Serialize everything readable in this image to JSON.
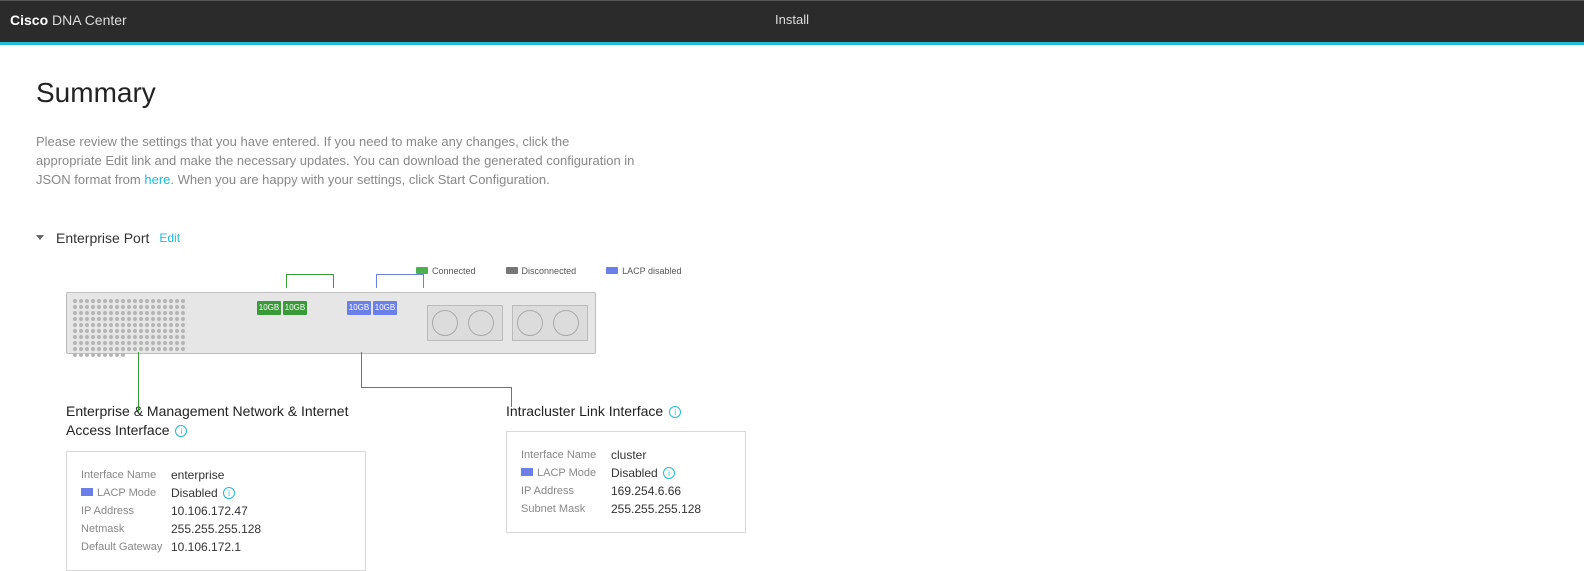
{
  "brand_bold": "Cisco",
  "brand_rest": " DNA Center",
  "tab": "Install",
  "title": "Summary",
  "intro1": "Please review the settings that you have entered. If you need to make any changes, click the appropriate Edit link and make the necessary updates. You can download the generated configuration in JSON format from ",
  "intro_link": "here",
  "intro2": ". When you are happy with your settings, click Start Configuration.",
  "section": "Enterprise Port",
  "edit": "Edit",
  "legend": {
    "connected": "Connected",
    "disconnected": "Disconnected",
    "lacp": "LACP disabled"
  },
  "tag": "10GB",
  "ent": {
    "title": "Enterprise & Management Network & Internet Access Interface",
    "name_lbl": "Interface Name",
    "name": "enterprise",
    "lacp_lbl": "LACP Mode",
    "lacp": "Disabled",
    "ip_lbl": "IP Address",
    "ip": "10.106.172.47",
    "mask_lbl": "Netmask",
    "mask": "255.255.255.128",
    "gw_lbl": "Default Gateway",
    "gw": "10.106.172.1"
  },
  "clu": {
    "title": "Intracluster Link Interface",
    "name_lbl": "Interface Name",
    "name": "cluster",
    "lacp_lbl": "LACP Mode",
    "lacp": "Disabled",
    "ip_lbl": "IP Address",
    "ip": "169.254.6.66",
    "mask_lbl": "Subnet Mask",
    "mask": "255.255.255.128"
  }
}
